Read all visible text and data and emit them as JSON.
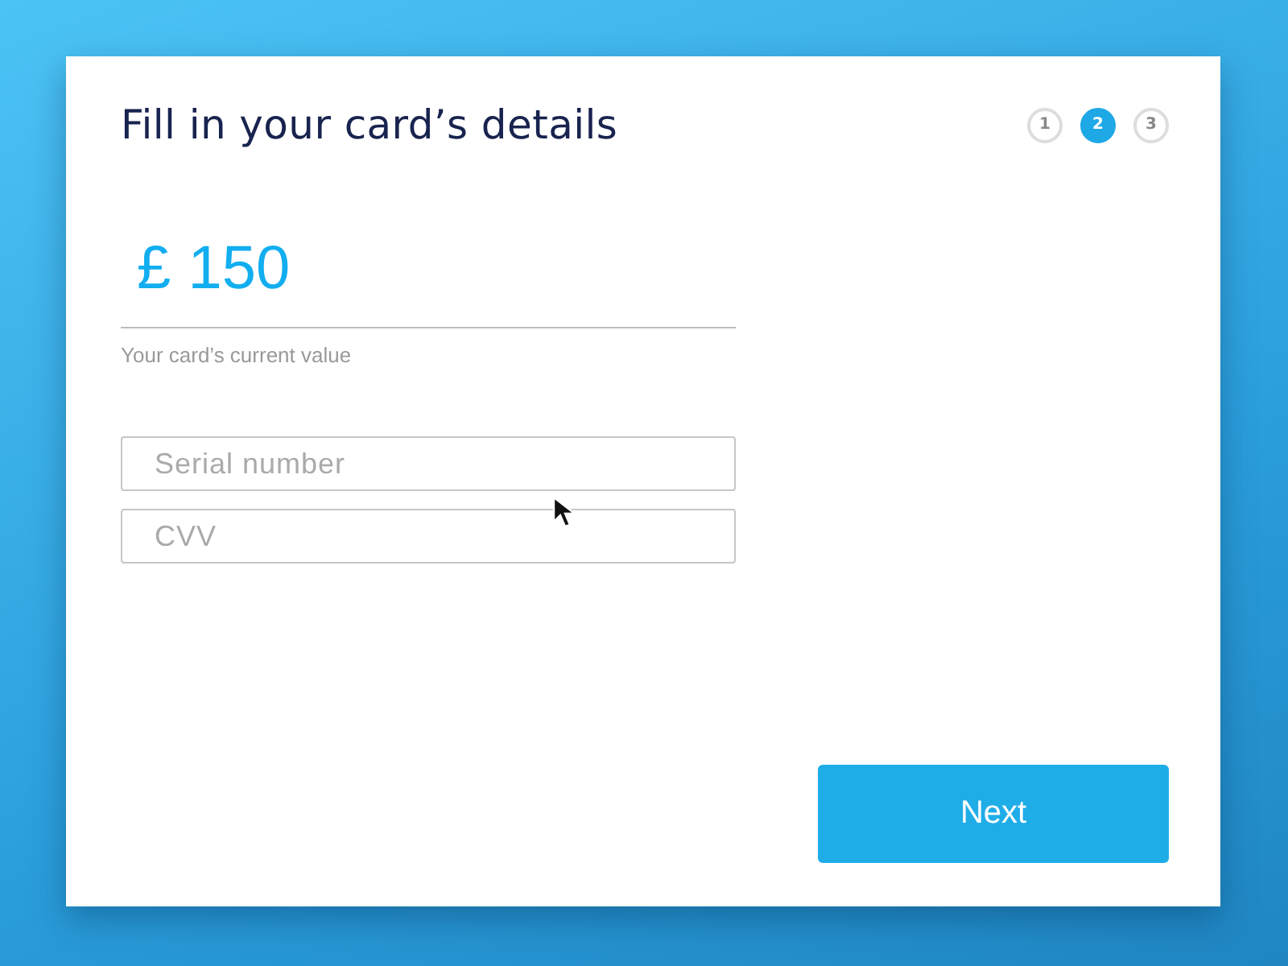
{
  "title": "Fill in your card’s details",
  "steps": [
    {
      "label": "1",
      "selected": false
    },
    {
      "label": "2",
      "selected": true
    },
    {
      "label": "3",
      "selected": false
    }
  ],
  "amount": "£ 150",
  "amount_caption": "Your card’s current value",
  "fields": [
    {
      "placeholder": "Serial number"
    },
    {
      "placeholder": "CVV"
    }
  ],
  "next_button": "Next"
}
